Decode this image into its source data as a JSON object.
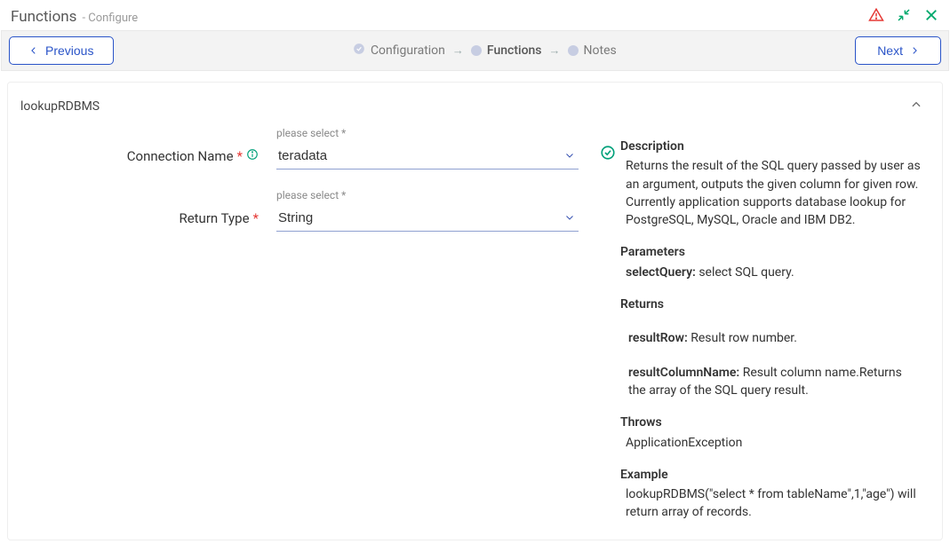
{
  "header": {
    "title": "Functions",
    "subtitle": "- Configure"
  },
  "nav": {
    "prev": "Previous",
    "next": "Next"
  },
  "steps": {
    "s1": "Configuration",
    "s2": "Functions",
    "s3": "Notes"
  },
  "panel": {
    "title": "lookupRDBMS"
  },
  "form": {
    "connection": {
      "label": "Connection Name",
      "float": "please select *",
      "value": "teradata"
    },
    "returnType": {
      "label": "Return Type",
      "float": "please select *",
      "value": "String"
    }
  },
  "desc": {
    "descriptionTitle": "Description",
    "descriptionText": "Returns the result of the SQL query passed by user as an argument, outputs the given column for given row. Currently application supports database lookup for PostgreSQL, MySQL, Oracle and IBM DB2.",
    "parametersTitle": "Parameters",
    "param1Name": "selectQuery:",
    "param1Text": " select SQL query.",
    "returnsTitle": "Returns",
    "ret1Name": "resultRow:",
    "ret1Text": " Result row number.",
    "ret2Name": "resultColumnName:",
    "ret2Text": " Result column name.Returns the array of the SQL query result.",
    "throwsTitle": "Throws",
    "throwsText": "ApplicationException",
    "exampleTitle": "Example",
    "exampleText": "lookupRDBMS(\"select * from tableName\",1,\"age\") will return array of records."
  }
}
